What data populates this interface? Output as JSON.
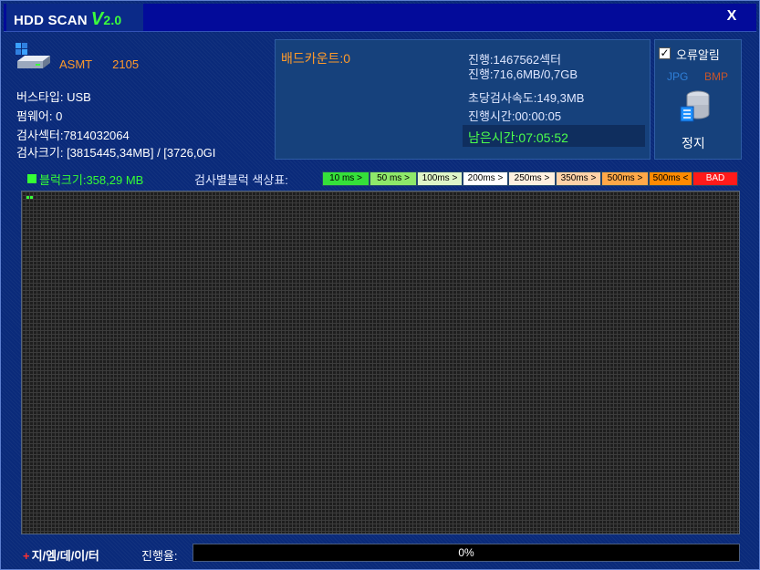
{
  "titlebar": {
    "app_name": "HDD SCAN",
    "version_letter": "V",
    "version_number": "2.0",
    "close_label": "X"
  },
  "drive": {
    "model": "ASMT",
    "model_number": "2105"
  },
  "info": {
    "bus_type": "버스타입: USB",
    "firmware": "펌웨어: 0",
    "sectors": "검사섹터:7814032064",
    "size": "검사크기: [3815445,34MB] / [3726,0GI"
  },
  "status": {
    "bad_count": "배드카운트:0",
    "progress_sectors": "진행:1467562섹터",
    "progress_size": "진행:716,6MB/0,7GB",
    "speed": "초당검사속도:149,3MB",
    "elapsed": "진행시간:00:00:05",
    "remaining": "남은시간:07:05:52"
  },
  "options": {
    "error_alarm_label": "오류알림",
    "error_alarm_checked": true,
    "jpg_label": "JPG",
    "bmp_label": "BMP",
    "stop_label": "정지"
  },
  "block": {
    "size_label": "블럭크기:358,29 MB",
    "legend_title": "검사별블럭 색상표:",
    "legend": [
      {
        "label": "10 ms >",
        "color": "#35e03a"
      },
      {
        "label": "50 ms >",
        "color": "#8ee86a"
      },
      {
        "label": "100ms >",
        "color": "#dff6c8"
      },
      {
        "label": "200ms >",
        "color": "#ffffff"
      },
      {
        "label": "250ms >",
        "color": "#fff0e0"
      },
      {
        "label": "350ms >",
        "color": "#ffd2a8"
      },
      {
        "label": "500ms >",
        "color": "#ffa848"
      },
      {
        "label": "500ms <",
        "color": "#ff8a00"
      },
      {
        "label": "BAD",
        "color": "#ff1a1a"
      }
    ],
    "completed_blocks": 2,
    "completed_color": "#35ff35"
  },
  "footer": {
    "logo_plus": "+",
    "logo_text": "지/엠/데/이/터",
    "progress_label": "진행율:",
    "progress_percent": 0,
    "progress_text": "0%"
  }
}
